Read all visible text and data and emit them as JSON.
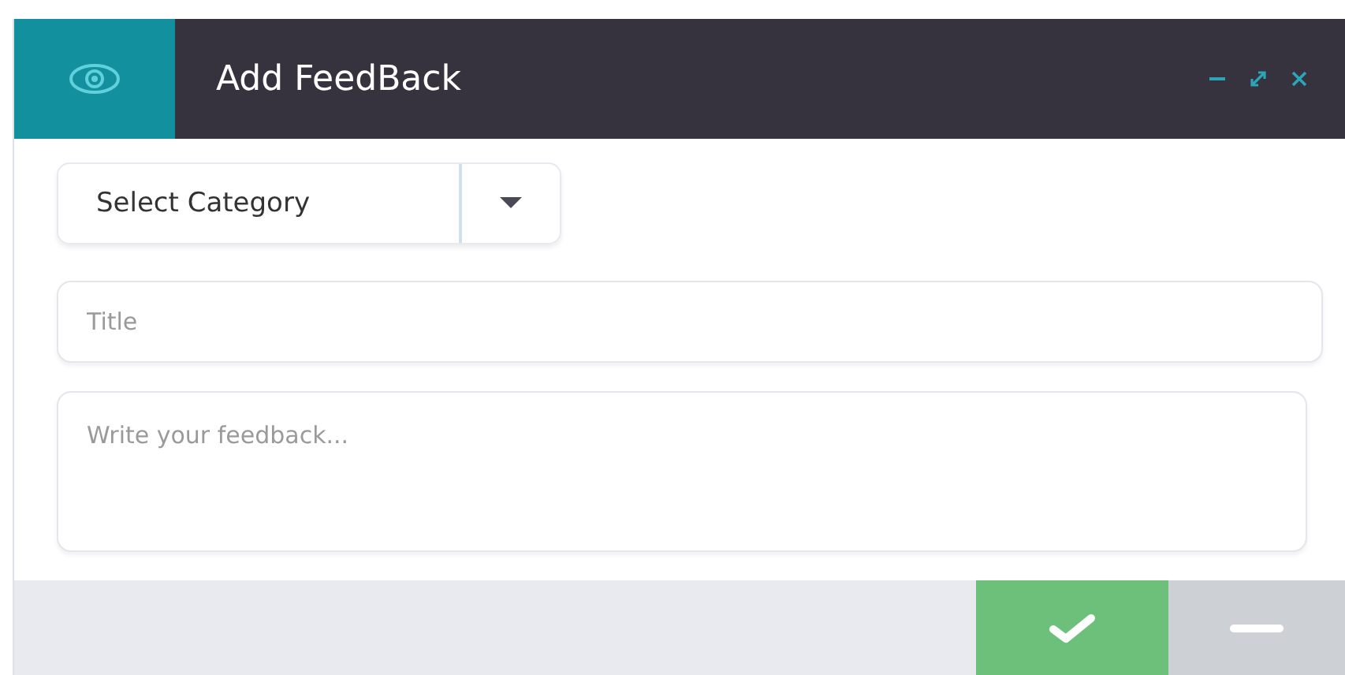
{
  "window": {
    "title": "Add FeedBack"
  },
  "form": {
    "category": {
      "value": "Select Category"
    },
    "title": {
      "placeholder": "Title"
    },
    "feedback": {
      "placeholder": "Write your feedback..."
    }
  }
}
